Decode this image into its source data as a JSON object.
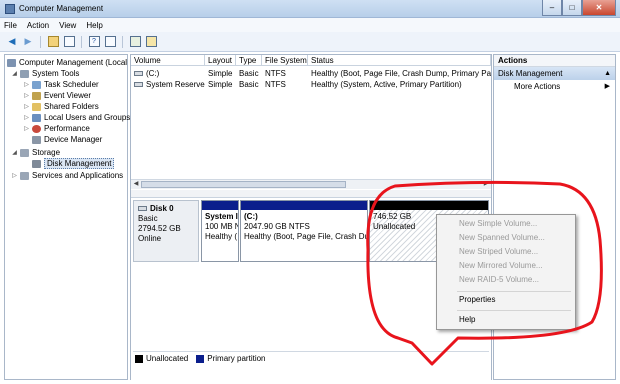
{
  "window": {
    "title": "Computer Management",
    "minimize_glyph": "–",
    "maximize_glyph": "□",
    "close_glyph": "✕"
  },
  "menu": [
    "File",
    "Action",
    "View",
    "Help"
  ],
  "tree": {
    "root": "Computer Management (Local",
    "system_tools": "System Tools",
    "task_scheduler": "Task Scheduler",
    "event_viewer": "Event Viewer",
    "shared_folders": "Shared Folders",
    "local_users": "Local Users and Groups",
    "performance": "Performance",
    "device_manager": "Device Manager",
    "storage": "Storage",
    "disk_management": "Disk Management",
    "services": "Services and Applications"
  },
  "volume_list": {
    "columns": [
      "Volume",
      "Layout",
      "Type",
      "File System",
      "Status"
    ],
    "rows": [
      {
        "volume": "(C:)",
        "layout": "Simple",
        "type": "Basic",
        "fs": "NTFS",
        "status": "Healthy (Boot, Page File, Crash Dump, Primary Partition)"
      },
      {
        "volume": "System Reserved",
        "layout": "Simple",
        "type": "Basic",
        "fs": "NTFS",
        "status": "Healthy (System, Active, Primary Partition)"
      }
    ]
  },
  "disk0": {
    "name": "Disk 0",
    "type": "Basic",
    "size": "2794.52 GB",
    "state": "Online",
    "partitions": [
      {
        "title": "System I",
        "line1": "100 MB N",
        "line2": "Healthy ("
      },
      {
        "title": "(C:)",
        "line1": "2047.90 GB NTFS",
        "line2": "Healthy (Boot, Page File, Crash Du"
      },
      {
        "title": "746.52 GB",
        "line1": "Unallocated",
        "line2": ""
      }
    ]
  },
  "legend": {
    "unallocated": "Unallocated",
    "primary": "Primary partition"
  },
  "actions": {
    "header": "Actions",
    "section": "Disk Management",
    "more": "More Actions"
  },
  "context_menu": {
    "items": [
      {
        "label": "New Simple Volume...",
        "enabled": false
      },
      {
        "label": "New Spanned Volume...",
        "enabled": false
      },
      {
        "label": "New Striped Volume...",
        "enabled": false
      },
      {
        "label": "New Mirrored Volume...",
        "enabled": false
      },
      {
        "label": "New RAID-5 Volume...",
        "enabled": false
      },
      {
        "label": "Properties",
        "enabled": true
      },
      {
        "label": "Help",
        "enabled": true
      }
    ]
  },
  "colors": {
    "primary_partition": "#0b1e8c",
    "unallocated": "#000000",
    "annotation": "#e8141c"
  }
}
